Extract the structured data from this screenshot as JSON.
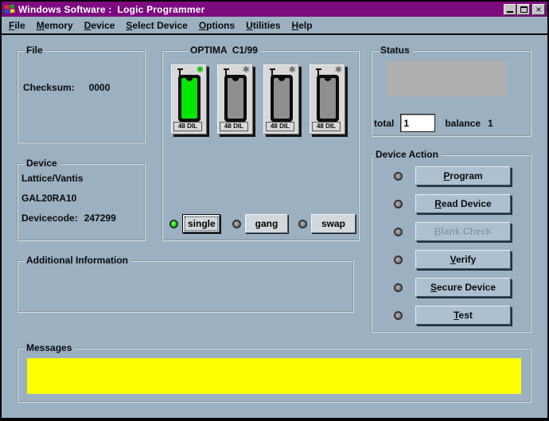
{
  "window": {
    "title": "Windows Software :  Logic Programmer"
  },
  "icons": {
    "app_icon": "windows-flag",
    "minimize": "minimize-bar",
    "maximize": "maximize-box",
    "close": "×",
    "socket_indicator": "✱",
    "led": "circle"
  },
  "menu": {
    "items": [
      {
        "label": "File"
      },
      {
        "label": "Memory"
      },
      {
        "label": "Device"
      },
      {
        "label": "Select Device"
      },
      {
        "label": "Options"
      },
      {
        "label": "Utilities"
      },
      {
        "label": "Help"
      }
    ]
  },
  "file_group": {
    "title": "File",
    "checksum_label": "Checksum:",
    "checksum_value": "0000"
  },
  "programmer_group": {
    "title": "OPTIMA  C1/99",
    "sockets": [
      {
        "label": "48 DIL",
        "state": "active"
      },
      {
        "label": "48 DIL",
        "state": "idle"
      },
      {
        "label": "48 DIL",
        "state": "idle"
      },
      {
        "label": "48 DIL",
        "state": "idle"
      }
    ],
    "modes": [
      {
        "label": "single",
        "selected": true
      },
      {
        "label": "gang",
        "selected": false
      },
      {
        "label": "swap",
        "selected": false
      }
    ]
  },
  "status_group": {
    "title": "Status",
    "display_text": "",
    "total_label": "total",
    "total_value": "1",
    "balance_label": "balance",
    "balance_value": "1"
  },
  "device_group": {
    "title": "Device",
    "manufacturer": "Lattice/Vantis",
    "part": "GAL20RA10",
    "devicecode_label": "Devicecode:",
    "devicecode_value": "247299"
  },
  "device_action_group": {
    "title": "Device Action",
    "actions": [
      {
        "label": "Program",
        "enabled": true
      },
      {
        "label": "Read Device",
        "enabled": true
      },
      {
        "label": "Blank Check",
        "enabled": false
      },
      {
        "label": "Verify",
        "enabled": true
      },
      {
        "label": "Secure Device",
        "enabled": true
      },
      {
        "label": "Test",
        "enabled": true
      }
    ]
  },
  "additional_info_group": {
    "title": "Additional Information",
    "content": ""
  },
  "messages_group": {
    "title": "Messages",
    "content": ""
  },
  "colors": {
    "titlebar": "#7E0A80",
    "background": "#9BB0C1",
    "action_button_face": "#ACC0D0",
    "active_socket": "#00E800",
    "idle_socket": "#8F8F8F",
    "message_area": "#FFFF00",
    "status_display": "#AFAFAF",
    "selected_led": "#00C400"
  }
}
